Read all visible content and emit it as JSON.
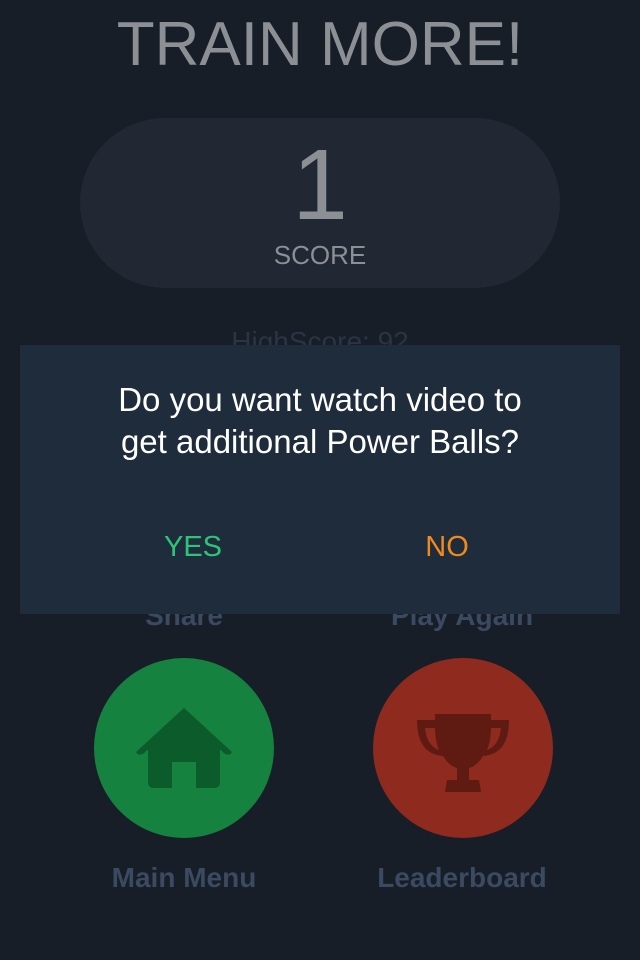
{
  "header": {
    "title": "TRAIN MORE!"
  },
  "score": {
    "value": "1",
    "label": "SCORE"
  },
  "highscore": {
    "text": "HighScore:  92"
  },
  "buttons": {
    "share_label": "Share",
    "play_again_label": "Play Again",
    "main_menu_label": "Main Menu",
    "leaderboard_label": "Leaderboard",
    "main_menu_icon": "home-icon",
    "leaderboard_icon": "trophy-icon"
  },
  "dialog": {
    "message_line1": "Do you want watch video to",
    "message_line2": "get additional Power Balls?",
    "yes_label": "YES",
    "no_label": "NO"
  },
  "colors": {
    "background": "#171e28",
    "dialog_background": "#1f2c3c",
    "yes_color": "#2dc479",
    "no_color": "#f08a1c",
    "main_menu_button": "#16823f",
    "leaderboard_button": "#8f2a1f",
    "caption_color": "#3a4a60"
  }
}
